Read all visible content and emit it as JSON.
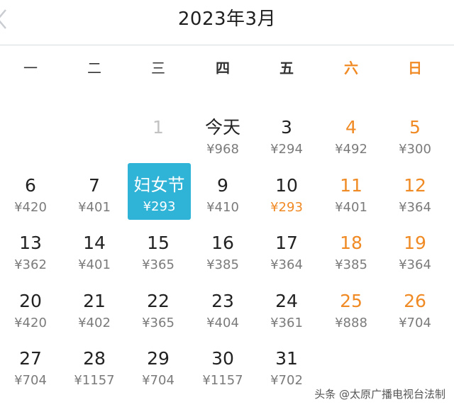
{
  "header": {
    "title": "2023年3月"
  },
  "weekdays": [
    "一",
    "二",
    "三",
    "四",
    "五",
    "六",
    "日"
  ],
  "days": [
    {
      "day": "1",
      "price": ""
    },
    {
      "day": "今天",
      "price": "¥968"
    },
    {
      "day": "3",
      "price": "¥294"
    },
    {
      "day": "4",
      "price": "¥492"
    },
    {
      "day": "5",
      "price": "¥300"
    },
    {
      "day": "6",
      "price": "¥420"
    },
    {
      "day": "7",
      "price": "¥401"
    },
    {
      "day": "妇女节",
      "price": "¥293"
    },
    {
      "day": "9",
      "price": "¥410"
    },
    {
      "day": "10",
      "price": "¥293"
    },
    {
      "day": "11",
      "price": "¥401"
    },
    {
      "day": "12",
      "price": "¥364"
    },
    {
      "day": "13",
      "price": "¥362"
    },
    {
      "day": "14",
      "price": "¥401"
    },
    {
      "day": "15",
      "price": "¥365"
    },
    {
      "day": "16",
      "price": "¥385"
    },
    {
      "day": "17",
      "price": "¥364"
    },
    {
      "day": "18",
      "price": "¥385"
    },
    {
      "day": "19",
      "price": "¥364"
    },
    {
      "day": "20",
      "price": "¥420"
    },
    {
      "day": "21",
      "price": "¥402"
    },
    {
      "day": "22",
      "price": "¥365"
    },
    {
      "day": "23",
      "price": "¥404"
    },
    {
      "day": "24",
      "price": "¥361"
    },
    {
      "day": "25",
      "price": "¥888"
    },
    {
      "day": "26",
      "price": "¥704"
    },
    {
      "day": "27",
      "price": "¥704"
    },
    {
      "day": "28",
      "price": "¥1157"
    },
    {
      "day": "29",
      "price": "¥704"
    },
    {
      "day": "30",
      "price": "¥1157"
    },
    {
      "day": "31",
      "price": "¥702"
    }
  ],
  "watermark": "头条 @太原广播电视台法制",
  "colors": {
    "accent": "#2fb3d6",
    "weekend": "#f08a24",
    "price": "#7b7b7b"
  },
  "icons": {
    "back": "chevron-left-icon"
  }
}
